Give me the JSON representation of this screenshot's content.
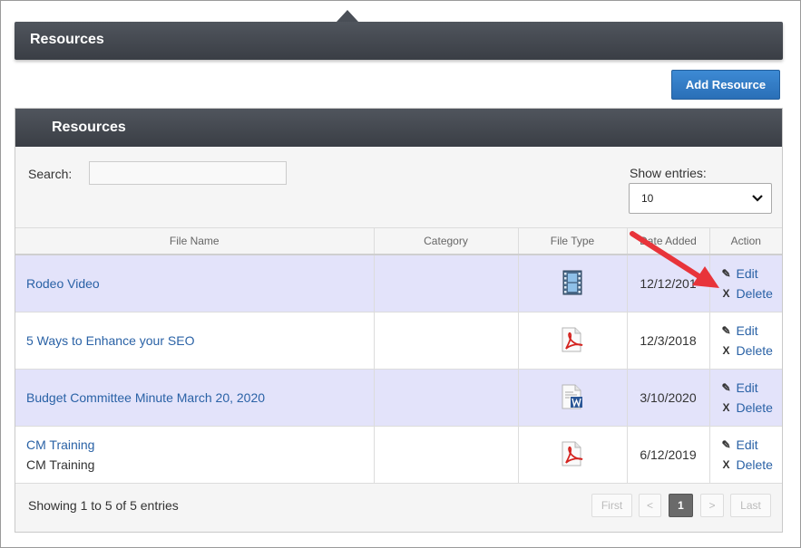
{
  "header": {
    "title": "Resources"
  },
  "toolbar": {
    "add_label": "Add Resource"
  },
  "panel": {
    "title": "Resources"
  },
  "search": {
    "label": "Search:",
    "value": ""
  },
  "entries": {
    "label": "Show entries:",
    "value": "10"
  },
  "table": {
    "columns": [
      "File Name",
      "Category",
      "File Type",
      "Date Added",
      "Action"
    ],
    "rows": [
      {
        "file_name": "Rodeo Video",
        "sub": "",
        "category": "",
        "file_type": "video-file-icon",
        "date": "12/12/201",
        "edit": "Edit",
        "delete": "Delete"
      },
      {
        "file_name": "5 Ways to Enhance your SEO",
        "sub": "",
        "category": "",
        "file_type": "pdf-file-icon",
        "date": "12/3/2018",
        "edit": "Edit",
        "delete": "Delete"
      },
      {
        "file_name": "Budget Committee Minute March 20, 2020",
        "sub": "",
        "category": "",
        "file_type": "word-file-icon",
        "date": "3/10/2020",
        "edit": "Edit",
        "delete": "Delete"
      },
      {
        "file_name": "CM Training",
        "sub": "CM Training",
        "category": "",
        "file_type": "pdf-file-icon",
        "date": "6/12/2019",
        "edit": "Edit",
        "delete": "Delete"
      }
    ]
  },
  "footer": {
    "info": "Showing 1 to 5 of 5 entries"
  },
  "pagination": {
    "first": "First",
    "prev": "<",
    "current": "1",
    "next": ">",
    "last": "Last"
  },
  "colors": {
    "header_bg": "#42464d",
    "button_bg": "#2f78c2",
    "row_highlight": "#e3e3fa",
    "link": "#2a62a6",
    "annotation_arrow": "#e8343a"
  }
}
